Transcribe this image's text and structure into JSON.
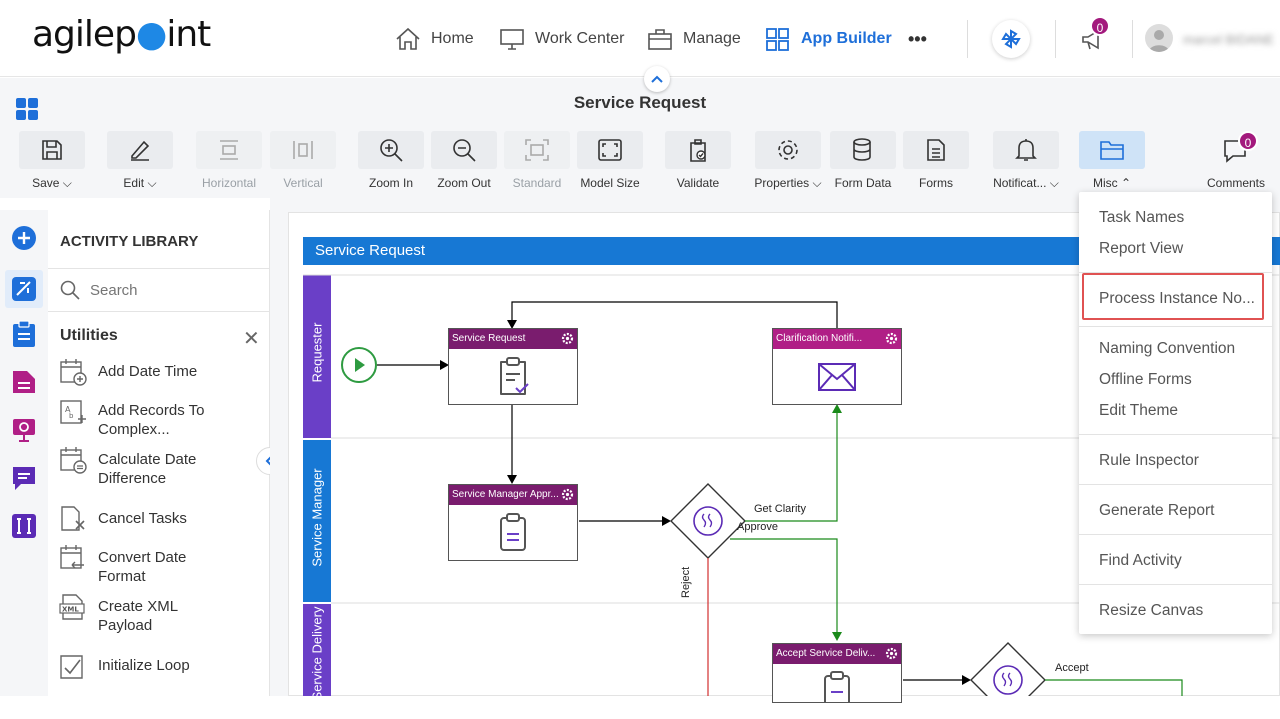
{
  "app": {
    "logo_text_1": "agilep",
    "logo_text_2": "int",
    "nav": [
      "Home",
      "Work Center",
      "Manage",
      "App Builder"
    ],
    "more": "•••",
    "notifications_count": "0",
    "user_name": "marcel BIDANE"
  },
  "page": {
    "title": "Service Request"
  },
  "toolbar": {
    "save": "Save",
    "edit": "Edit",
    "horizontal": "Horizontal",
    "vertical": "Vertical",
    "zoom_in": "Zoom In",
    "zoom_out": "Zoom Out",
    "standard": "Standard",
    "model_size": "Model Size",
    "validate": "Validate",
    "properties": "Properties",
    "form_data": "Form Data",
    "forms": "Forms",
    "notifications": "Notificat...",
    "misc": "Misc",
    "comments": "Comments",
    "comments_count": "0"
  },
  "library": {
    "heading": "ACTIVITY LIBRARY",
    "search_placeholder": "Search",
    "category": "Utilities",
    "items": [
      {
        "l1": "Add Date Time",
        "l2": ""
      },
      {
        "l1": "Add Records To",
        "l2": "Complex..."
      },
      {
        "l1": "Calculate Date",
        "l2": "Difference"
      },
      {
        "l1": "Cancel Tasks",
        "l2": ""
      },
      {
        "l1": "Convert Date",
        "l2": "Format"
      },
      {
        "l1": "Create XML",
        "l2": "Payload"
      },
      {
        "l1": "Initialize Loop",
        "l2": ""
      }
    ]
  },
  "process": {
    "pool": "Service Request",
    "lanes": [
      "Requester",
      "Service Manager",
      "Service Delivery"
    ],
    "tasks": [
      "Service Request",
      "Clarification Notifi...",
      "Service Manager Appr...",
      "Accept Service Deliv..."
    ],
    "edges": [
      "Get Clarity",
      "Approve",
      "Reject",
      "Accept"
    ]
  },
  "misc_menu": [
    "Task Names",
    "Report View",
    "Process Instance No...",
    "Naming Convention",
    "Offline Forms",
    "Edit Theme",
    "Rule Inspector",
    "Generate Report",
    "Find Activity",
    "Resize Canvas"
  ]
}
